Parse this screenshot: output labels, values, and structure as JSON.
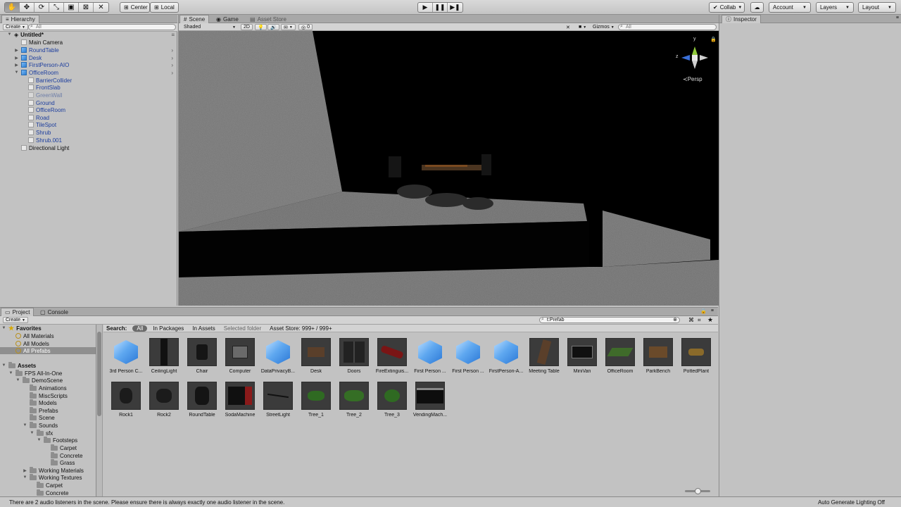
{
  "toolbar": {
    "pivot_label": "Center",
    "space_label": "Local",
    "collab_label": "Collab",
    "account_label": "Account",
    "layers_label": "Layers",
    "layout_label": "Layout"
  },
  "hierarchy": {
    "tab_label": "Hierarchy",
    "create_label": "Create",
    "search_placeholder": "All",
    "scene_name": "Untitled*",
    "items": [
      {
        "label": "Main Camera"
      },
      {
        "label": "RoundTable"
      },
      {
        "label": "Desk"
      },
      {
        "label": "FirstPerson-AIO"
      },
      {
        "label": "OfficeRoom"
      },
      {
        "label": "BarrierCollider"
      },
      {
        "label": "FrontSlab"
      },
      {
        "label": "GreenWall"
      },
      {
        "label": "Ground"
      },
      {
        "label": "OfficeRoom"
      },
      {
        "label": "Road"
      },
      {
        "label": "TileSpot"
      },
      {
        "label": "Shrub"
      },
      {
        "label": "Shrub.001"
      },
      {
        "label": "Directional Light"
      }
    ]
  },
  "scene": {
    "tabs": [
      {
        "label": "Scene"
      },
      {
        "label": "Game"
      },
      {
        "label": "Asset Store"
      }
    ],
    "shading_mode": "Shaded",
    "mode_2d": "2D",
    "effects_count": "0",
    "gizmos_label": "Gizmos",
    "search_placeholder": "All",
    "projection_label": "Persp",
    "axis_y": "y",
    "axis_z": "z"
  },
  "inspector": {
    "tab_label": "Inspector"
  },
  "project": {
    "tabs": [
      {
        "label": "Project"
      },
      {
        "label": "Console"
      }
    ],
    "create_label": "Create",
    "search_value": "t:Prefab",
    "search_bar": {
      "search_label": "Search:",
      "all": "All",
      "in_packages": "In Packages",
      "in_assets": "In Assets",
      "selected_folder": "Selected folder",
      "asset_store": "Asset Store: 999+ / 999+"
    },
    "tree": [
      {
        "label": "Favorites"
      },
      {
        "label": "All Materials"
      },
      {
        "label": "All Models"
      },
      {
        "label": "All Prefabs"
      },
      {
        "label": "Assets"
      },
      {
        "label": "FPS All-In-One"
      },
      {
        "label": "DemoScene"
      },
      {
        "label": "Animations"
      },
      {
        "label": "MiscScripts"
      },
      {
        "label": "Models"
      },
      {
        "label": "Prefabs"
      },
      {
        "label": "Scene"
      },
      {
        "label": "Sounds"
      },
      {
        "label": "sfx"
      },
      {
        "label": "Footsteps"
      },
      {
        "label": "Carpet"
      },
      {
        "label": "Concrete"
      },
      {
        "label": "Grass"
      },
      {
        "label": "Working Materials"
      },
      {
        "label": "Working Textures"
      },
      {
        "label": "Carpet"
      },
      {
        "label": "Concrete"
      }
    ],
    "assets": [
      {
        "label": "3rd Person C..."
      },
      {
        "label": "CeilingLight"
      },
      {
        "label": "Chair"
      },
      {
        "label": "Computer"
      },
      {
        "label": "DataPrivacyB..."
      },
      {
        "label": "Desk"
      },
      {
        "label": "Doors"
      },
      {
        "label": "FireExtinguis..."
      },
      {
        "label": "First Person ..."
      },
      {
        "label": "First Person ..."
      },
      {
        "label": "FirstPerson-A..."
      },
      {
        "label": "Meeting Table"
      },
      {
        "label": "MiniVan"
      },
      {
        "label": "OfficeRoom"
      },
      {
        "label": "ParkBench"
      },
      {
        "label": "PottedPlant"
      },
      {
        "label": "Rock1"
      },
      {
        "label": "Rock2"
      },
      {
        "label": "RoundTable"
      },
      {
        "label": "SodaMachine"
      },
      {
        "label": "StreetLight"
      },
      {
        "label": "Tree_1"
      },
      {
        "label": "Tree_2"
      },
      {
        "label": "Tree_3"
      },
      {
        "label": "VendingMach..."
      }
    ]
  },
  "status": {
    "message": "There are 2 audio listeners in the scene. Please ensure there is always exactly one audio listener in the scene.",
    "lighting": "Auto Generate Lighting Off"
  }
}
